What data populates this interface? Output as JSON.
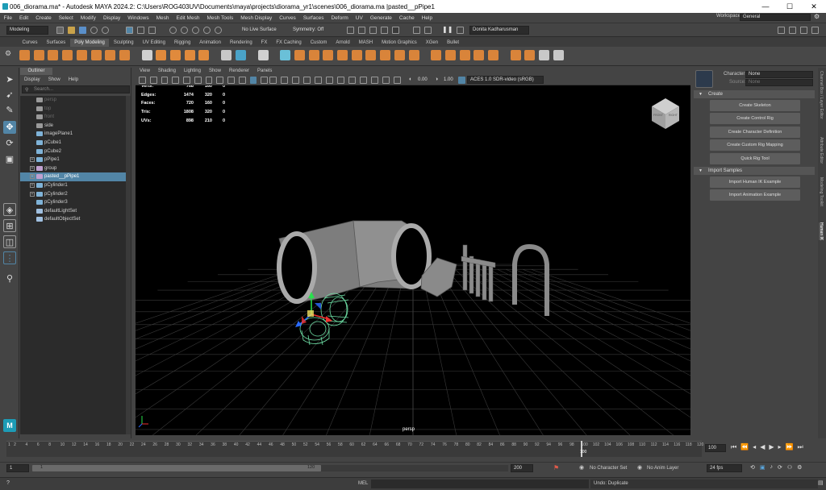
{
  "window": {
    "title": "006_diorama.ma* - Autodesk MAYA 2024.2: C:\\Users\\ROG403UV\\Documents\\maya\\projects\\diorama_yr1\\scenes\\006_diorama.ma    |pasted__pPipe1",
    "minimize": "—",
    "maximize": "☐",
    "close": "✕"
  },
  "menubar": [
    "File",
    "Edit",
    "Create",
    "Select",
    "Modify",
    "Display",
    "Windows",
    "Mesh",
    "Edit Mesh",
    "Mesh Tools",
    "Mesh Display",
    "Curves",
    "Surfaces",
    "Deform",
    "UV",
    "Generate",
    "Cache",
    "Help"
  ],
  "workspace": {
    "label": "Workspace:",
    "value": "General"
  },
  "statusline": {
    "mode": "Modeling",
    "live_surface": "No Live Surface",
    "symmetry": "Symmetry: Off",
    "user": "Donita Kadharusman"
  },
  "shelf_tabs": [
    "Curves",
    "Surfaces",
    "Poly Modeling",
    "Sculpting",
    "UV Editing",
    "Rigging",
    "Animation",
    "Rendering",
    "FX",
    "FX Caching",
    "Custom",
    "Arnold",
    "MASH",
    "Motion Graphics",
    "XGen",
    "Bullet"
  ],
  "shelf_active": "Poly Modeling",
  "shelf_colors": [
    "#d9843a",
    "#d9843a",
    "#d9843a",
    "#d9843a",
    "#d9843a",
    "#d9843a",
    "#d9843a",
    "#d9843a",
    "#d0d0d0",
    "#e08a3c",
    "#e08a3c",
    "#e08a3c",
    "#e08a3c",
    "#c8c8c8",
    "#4aa3c8",
    "#d0d0d0",
    "#6ac0d8",
    "#d9843a",
    "#d9843a",
    "#d9843a",
    "#d9843a",
    "#d9843a",
    "#d9843a",
    "#d9843a",
    "#d9843a",
    "#d9843a",
    "#d9843a",
    "#d9843a",
    "#d9843a",
    "#d9843a",
    "#d9843a",
    "#d9843a",
    "#d9843a",
    "#c8c8c8",
    "#c8c8c8"
  ],
  "outliner": {
    "tab": "Outliner",
    "menus": [
      "Display",
      "Show",
      "Help"
    ],
    "search_placeholder": "Search...",
    "items": [
      {
        "name": "persp",
        "type": "camera",
        "dim": true,
        "expand": false
      },
      {
        "name": "top",
        "type": "camera",
        "dim": true,
        "expand": false
      },
      {
        "name": "front",
        "type": "camera",
        "dim": true,
        "expand": false
      },
      {
        "name": "side",
        "type": "camera",
        "dim": false,
        "expand": false
      },
      {
        "name": "imagePlane1",
        "type": "mesh",
        "dim": false,
        "expand": false
      },
      {
        "name": "pCube1",
        "type": "mesh",
        "dim": false,
        "expand": false
      },
      {
        "name": "pCube2",
        "type": "mesh",
        "dim": false,
        "expand": false
      },
      {
        "name": "pPipe1",
        "type": "mesh",
        "dim": false,
        "expand": true
      },
      {
        "name": "group",
        "type": "group",
        "dim": false,
        "expand": true
      },
      {
        "name": "pasted__pPipe1",
        "type": "group",
        "dim": false,
        "expand": true,
        "selected": true
      },
      {
        "name": "pCylinder1",
        "type": "mesh",
        "dim": false,
        "expand": true
      },
      {
        "name": "pCylinder2",
        "type": "mesh",
        "dim": false,
        "expand": true
      },
      {
        "name": "pCylinder3",
        "type": "mesh",
        "dim": false,
        "expand": false
      },
      {
        "name": "defaultLightSet",
        "type": "set",
        "dim": false,
        "expand": false
      },
      {
        "name": "defaultObjectSet",
        "type": "set",
        "dim": false,
        "expand": false
      }
    ]
  },
  "panel_menu": [
    "View",
    "Shading",
    "Lighting",
    "Show",
    "Renderer",
    "Panels"
  ],
  "panel_toolbar": {
    "exposure": "0.00",
    "gamma": "1.00",
    "colorspace": "ACES 1.0 SDR-video (sRGB)"
  },
  "hud": [
    {
      "label": "Verts:",
      "v1": "768",
      "v2": "160",
      "v3": "0"
    },
    {
      "label": "Edges:",
      "v1": "1474",
      "v2": "320",
      "v3": "0"
    },
    {
      "label": "Faces:",
      "v1": "720",
      "v2": "160",
      "v3": "0"
    },
    {
      "label": "Tris:",
      "v1": "1808",
      "v2": "320",
      "v3": "0"
    },
    {
      "label": "UVs:",
      "v1": "898",
      "v2": "210",
      "v3": "0"
    }
  ],
  "viewport": {
    "camera": "persp",
    "viewcube_front": "FRONT",
    "viewcube_right": "RIGHT"
  },
  "human_ik": {
    "character_label": "Character:",
    "character_value": "None",
    "source_label": "Source:",
    "source_value": "None",
    "section_create": "Create",
    "create_buttons": [
      "Create Skeleton",
      "Create Control Rig",
      "Create Character Definition",
      "Create Custom Rig Mapping",
      "Quick Rig Tool"
    ],
    "section_import": "Import Samples",
    "import_buttons": [
      "Import Human IK Example",
      "Import Animation Example"
    ]
  },
  "side_tabs": [
    "Channel Box / Layer Editor",
    "Attribute Editor",
    "Modeling Toolkit",
    "Human IK"
  ],
  "timeline": {
    "ticks": [
      "1",
      "2",
      "4",
      "6",
      "8",
      "10",
      "12",
      "14",
      "16",
      "18",
      "20",
      "22",
      "24",
      "26",
      "28",
      "30",
      "32",
      "34",
      "36",
      "38",
      "40",
      "42",
      "44",
      "46",
      "48",
      "50",
      "52",
      "54",
      "56",
      "58",
      "60",
      "62",
      "64",
      "66",
      "68",
      "70",
      "72",
      "74",
      "76",
      "78",
      "80",
      "82",
      "84",
      "86",
      "88",
      "90",
      "92",
      "94",
      "96",
      "98",
      "100",
      "102",
      "104",
      "106",
      "108",
      "110",
      "112",
      "114",
      "116",
      "118",
      "120"
    ],
    "current_frame": "100",
    "current_field": "100"
  },
  "range": {
    "start": "1",
    "inner_start": "1",
    "inner_end": "120",
    "end": "200",
    "character_set": "No Character Set",
    "anim_layer": "No Anim Layer",
    "fps": "24 fps"
  },
  "cmdline": {
    "lang": "MEL",
    "feedback": "Undo: Duplicate"
  }
}
